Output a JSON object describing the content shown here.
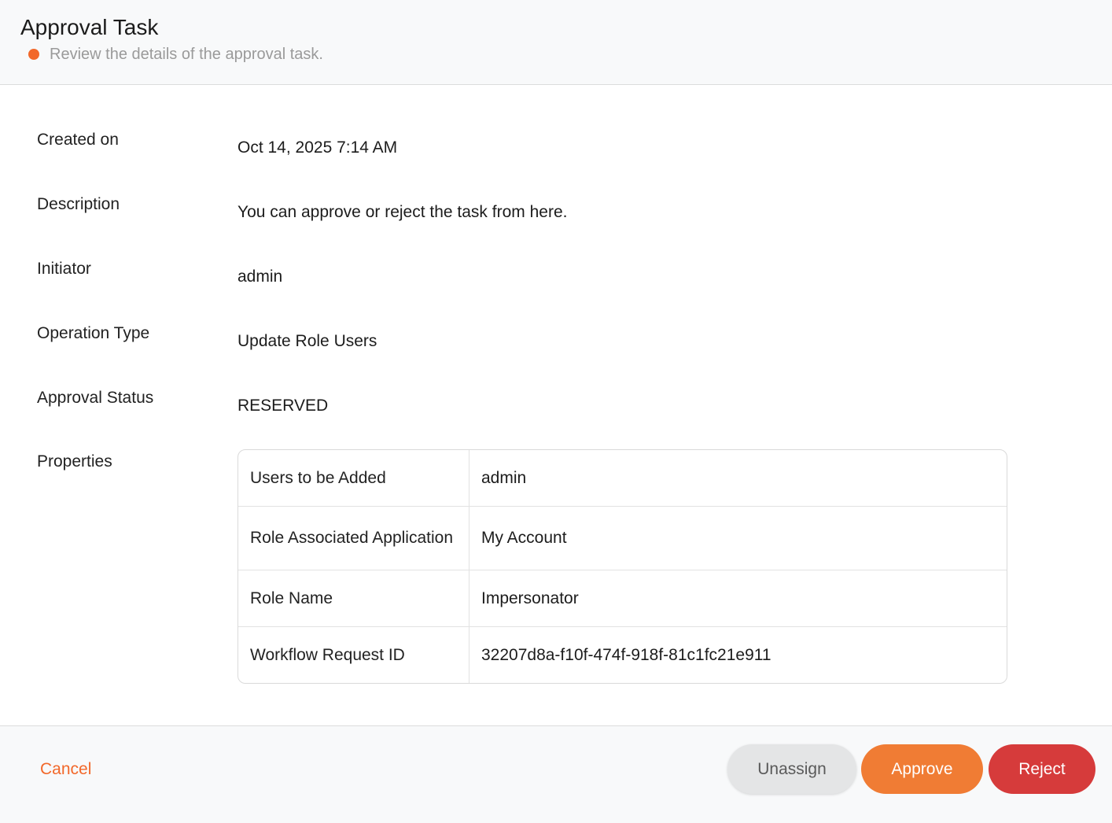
{
  "header": {
    "title": "Approval Task",
    "subtitle": "Review the details of the approval task.",
    "status_dot_color": "#f2682a"
  },
  "fields": {
    "created_on": {
      "label": "Created on",
      "value": "Oct 14, 2025 7:14 AM"
    },
    "description": {
      "label": "Description",
      "value": "You can approve or reject the task from here."
    },
    "initiator": {
      "label": "Initiator",
      "value": "admin"
    },
    "operation_type": {
      "label": "Operation Type",
      "value": "Update Role Users"
    },
    "approval_status": {
      "label": "Approval Status",
      "value": "RESERVED"
    },
    "properties": {
      "label": "Properties"
    }
  },
  "properties": [
    {
      "key": "Users to be Added",
      "value": "admin"
    },
    {
      "key": "Role Associated Application",
      "value": "My Account"
    },
    {
      "key": "Role Name",
      "value": "Impersonator"
    },
    {
      "key": "Workflow Request ID",
      "value": "32207d8a-f10f-474f-918f-81c1fc21e911"
    }
  ],
  "footer": {
    "cancel_label": "Cancel",
    "unassign_label": "Unassign",
    "approve_label": "Approve",
    "reject_label": "Reject"
  },
  "colors": {
    "accent": "#f2682a",
    "approve": "#f07c34",
    "reject": "#d63b3b",
    "unassign": "#e4e5e6"
  }
}
